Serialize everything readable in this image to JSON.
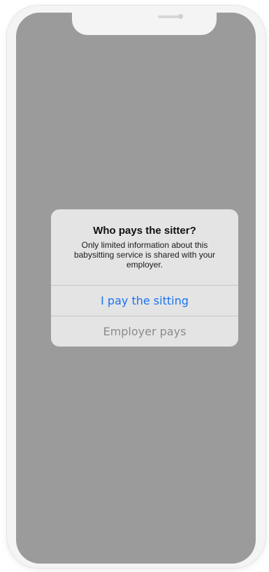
{
  "alert": {
    "title": "Who pays the sitter?",
    "message": "Only limited information about this babysitting service is shared with your employer.",
    "primary_action": "I pay the sitting",
    "secondary_action": "Employer pays"
  },
  "colors": {
    "overlay": "#9b9b9b",
    "dialog_background": "#e4e4e4",
    "primary_action": "#1a73f2",
    "secondary_action": "#8b8b8b",
    "frame": "#f4f4f5"
  }
}
